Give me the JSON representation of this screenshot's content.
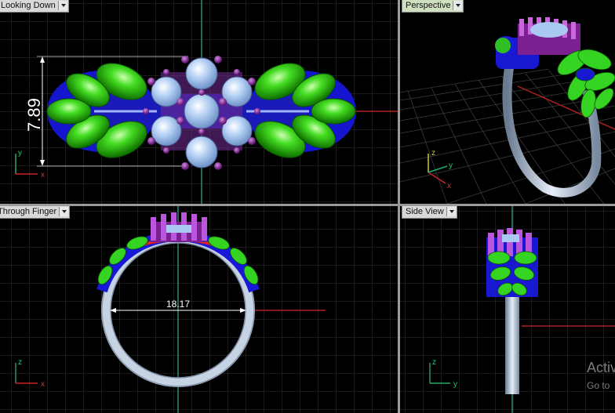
{
  "viewports": {
    "top": {
      "label": "Looking Down",
      "dimension": "7.89"
    },
    "perspective": {
      "label": "Perspective"
    },
    "front": {
      "label": "Through Finger",
      "dimension": "18.17"
    },
    "side": {
      "label": "Side View"
    }
  },
  "axes": {
    "x": "x",
    "y": "y",
    "z": "z"
  },
  "watermark": {
    "line1": "Activ",
    "line2": "Go to"
  },
  "colors": {
    "leaf": "#33cc22",
    "stone": "#a9c8f2",
    "prong": "#8a2a9a",
    "setting": "#1a1aff",
    "band": "#b8c8d8",
    "grid": "#3a3a3a",
    "axis_x": "#cc2222",
    "axis_y": "#22aa66"
  }
}
